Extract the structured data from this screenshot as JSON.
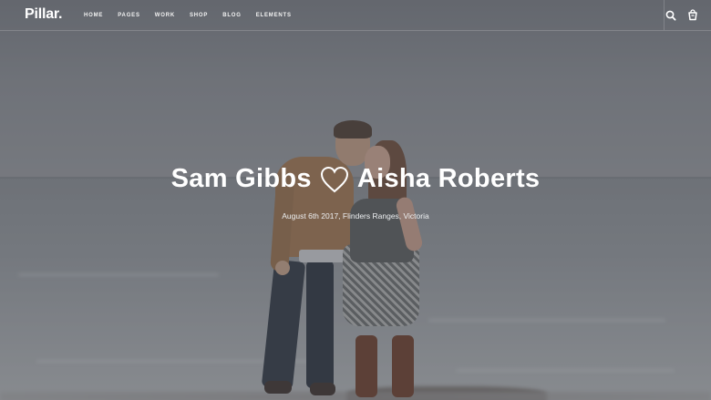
{
  "brand": {
    "logo_text": "Pillar."
  },
  "nav": {
    "items": [
      {
        "label": "HOME"
      },
      {
        "label": "PAGES"
      },
      {
        "label": "WORK"
      },
      {
        "label": "SHOP"
      },
      {
        "label": "BLOG"
      },
      {
        "label": "ELEMENTS"
      }
    ],
    "icons": [
      "search-icon",
      "cart-icon"
    ]
  },
  "hero": {
    "name_one": "Sam Gibbs",
    "name_two": "Aisha Roberts",
    "heart_icon": "heart-outline-icon",
    "subtitle": "August 6th 2017, Flinders Ranges, Victoria"
  },
  "colors": {
    "text": "#ffffff",
    "overlay": "#46484e"
  }
}
